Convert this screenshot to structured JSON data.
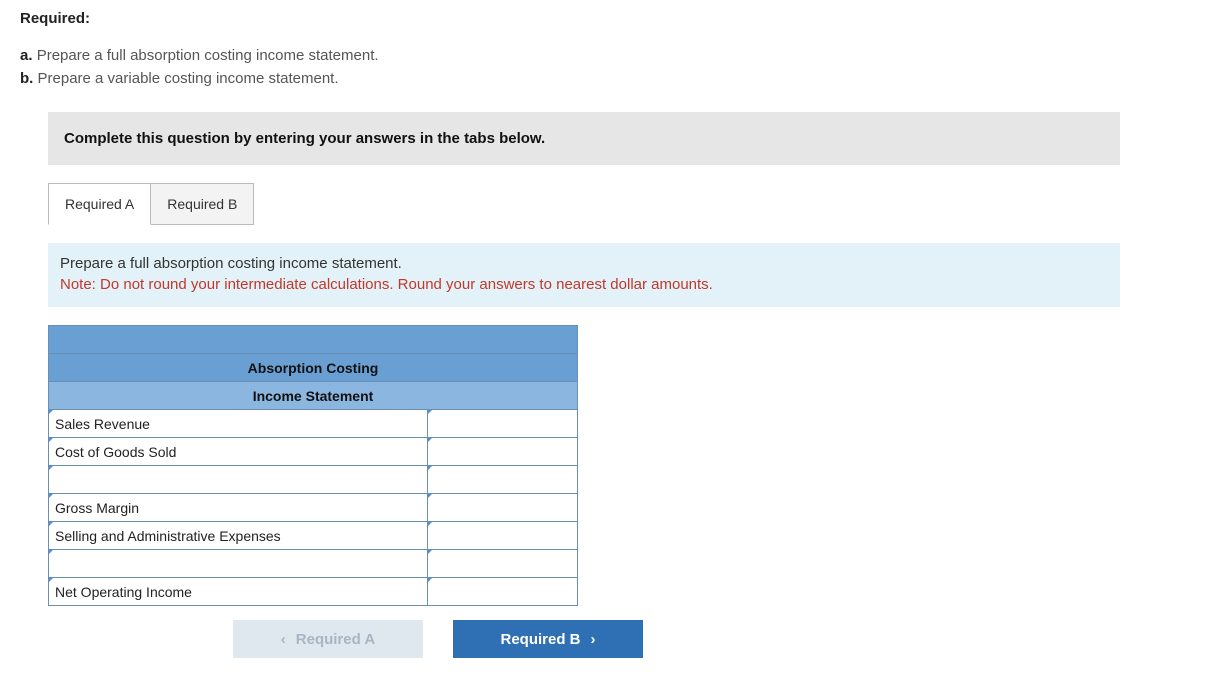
{
  "header": "Required:",
  "requirements": {
    "a_label": "a.",
    "a_text": "Prepare a full absorption costing income statement.",
    "b_label": "b.",
    "b_text": "Prepare a variable costing income statement."
  },
  "instruction": "Complete this question by entering your answers in the tabs below.",
  "tabs": {
    "a": "Required A",
    "b": "Required B"
  },
  "prompt": {
    "line1": "Prepare a full absorption costing income statement.",
    "note": "Note: Do not round your intermediate calculations. Round your answers to nearest dollar amounts."
  },
  "table": {
    "title": "Absorption Costing",
    "subtitle": "Income Statement",
    "rows": {
      "sales_revenue": "Sales Revenue",
      "cogs": "Cost of Goods Sold",
      "blank1": "",
      "gross_margin": "Gross Margin",
      "sa_exp": "Selling and Administrative Expenses",
      "blank2": "",
      "net_op_income": "Net Operating Income"
    }
  },
  "nav": {
    "prev": "Required A",
    "next": "Required B"
  }
}
